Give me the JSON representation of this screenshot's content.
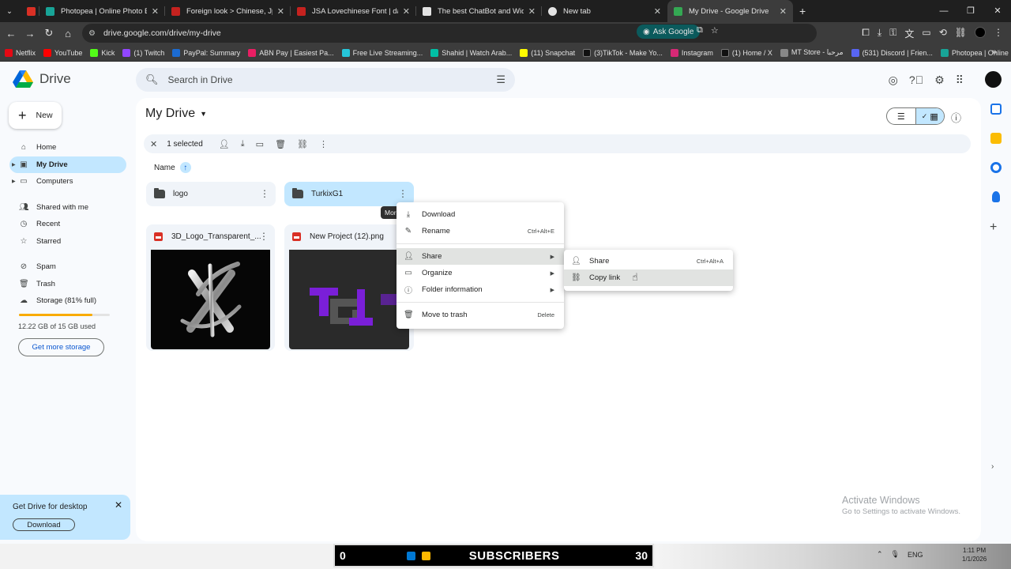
{
  "browser": {
    "tabs": [
      {
        "title": "",
        "favicon_color": "#d93025"
      },
      {
        "title": "Photopea | Online Photo Editor",
        "favicon_color": "#18a497"
      },
      {
        "title": "Foreign look > Chinese, Jpn for",
        "favicon_color": "#c5221f"
      },
      {
        "title": "JSA Lovechinese Font | dafont.c",
        "favicon_color": "#c5221f"
      },
      {
        "title": "The best ChatBot and Widgets",
        "favicon_color": "#e3e3e3"
      },
      {
        "title": "New tab",
        "favicon_color": "#e3e3e3"
      },
      {
        "title": "My Drive - Google Drive",
        "favicon_color": "#34a853"
      }
    ],
    "url": "drive.google.com/drive/my-drive",
    "ask_google": "Ask Google",
    "bookmarks": [
      {
        "label": "Netflix",
        "color": "#e50914"
      },
      {
        "label": "YouTube",
        "color": "#ff0000"
      },
      {
        "label": "Kick",
        "color": "#53fc18"
      },
      {
        "label": "(1) Twitch",
        "color": "#9146ff"
      },
      {
        "label": "PayPal: Summary",
        "color": "#1c6bd1"
      },
      {
        "label": "ABN Pay | Easiest Pa...",
        "color": "#e91e63"
      },
      {
        "label": "Free Live Streaming...",
        "color": "#26c6da"
      },
      {
        "label": "Shahid | Watch Arab...",
        "color": "#00bfa5"
      },
      {
        "label": "(11) Snapchat",
        "color": "#fffc00"
      },
      {
        "label": "(3)TikTok - Make Yo...",
        "color": "#111111"
      },
      {
        "label": "Instagram",
        "color": "#d62976"
      },
      {
        "label": "(1) Home / X",
        "color": "#111111"
      },
      {
        "label": "MT Store - مرحبا",
        "color": "#888888"
      },
      {
        "label": "(531) Discord | Frien...",
        "color": "#5865f2"
      },
      {
        "label": "Photopea | Online P...",
        "color": "#18a497"
      }
    ]
  },
  "drive": {
    "brand": "Drive",
    "search_placeholder": "Search in Drive",
    "new_label": "New",
    "nav": [
      {
        "label": "Home",
        "icon": "home-icon"
      },
      {
        "label": "My Drive",
        "icon": "drive-icon"
      },
      {
        "label": "Computers",
        "icon": "computer-icon"
      },
      {
        "label": "Shared with me",
        "icon": "people-icon"
      },
      {
        "label": "Recent",
        "icon": "clock-icon"
      },
      {
        "label": "Starred",
        "icon": "star-icon"
      },
      {
        "label": "Spam",
        "icon": "spam-icon"
      },
      {
        "label": "Trash",
        "icon": "trash-icon"
      },
      {
        "label": "Storage (81% full)",
        "icon": "cloud-icon"
      }
    ],
    "storage_used_fraction": 0.81,
    "storage_text": "12.22 GB of 15 GB used",
    "get_more_storage": "Get more storage",
    "desktop_card": {
      "title": "Get Drive for desktop",
      "button": "Download"
    },
    "page_title": "My Drive",
    "selected_text": "1 selected",
    "sort_label": "Name",
    "folders": [
      {
        "name": "logo",
        "selected": false
      },
      {
        "name": "TurkixG1",
        "selected": true
      }
    ],
    "files": [
      {
        "name": "3D_Logo_Transparent_...",
        "type": "image"
      },
      {
        "name": "New Project (12).png",
        "type": "image"
      }
    ],
    "tooltip": "More actions",
    "context_menu": [
      {
        "label": "Download",
        "shortcut": "",
        "icon": "download-icon",
        "submenu": false
      },
      {
        "label": "Rename",
        "shortcut": "Ctrl+Alt+E",
        "icon": "rename-icon",
        "submenu": false
      },
      {
        "label": "Share",
        "shortcut": "",
        "icon": "share-icon",
        "submenu": true
      },
      {
        "label": "Organize",
        "shortcut": "",
        "icon": "folder-move-icon",
        "submenu": true
      },
      {
        "label": "Folder information",
        "shortcut": "",
        "icon": "info-icon",
        "submenu": true
      },
      {
        "label": "Move to trash",
        "shortcut": "Delete",
        "icon": "trash-icon",
        "submenu": false
      }
    ],
    "share_submenu": [
      {
        "label": "Share",
        "shortcut": "Ctrl+Alt+A"
      },
      {
        "label": "Copy link",
        "shortcut": ""
      }
    ],
    "accent_color": "#0b57d0",
    "selection_color": "#c2e7ff"
  },
  "windows": {
    "watermark_title": "Activate Windows",
    "watermark_sub": "Go to Settings to activate Windows.",
    "overlay_left": "0",
    "overlay_text": "SUBSCRIBERS",
    "overlay_right": "30",
    "lang": "ENG",
    "time": "1:11 PM",
    "date": "1/1/2026"
  }
}
